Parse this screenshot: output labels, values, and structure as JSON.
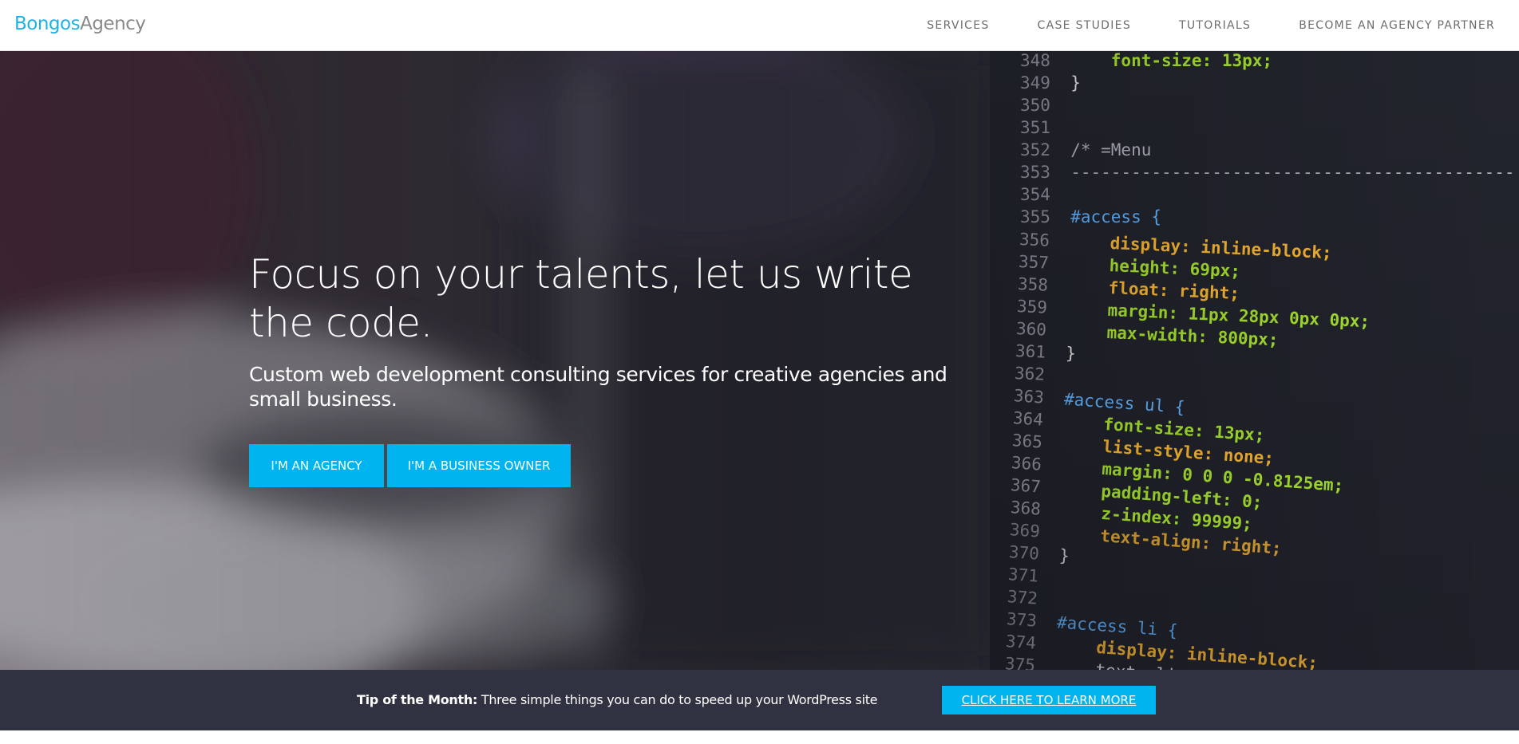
{
  "brand": {
    "part1": "Bongos",
    "part2": "Agency"
  },
  "nav": {
    "items": [
      {
        "label": "SERVICES"
      },
      {
        "label": "CASE STUDIES"
      },
      {
        "label": "TUTORIALS"
      },
      {
        "label": "BECOME AN AGENCY PARTNER"
      }
    ]
  },
  "hero": {
    "title": "Focus on your talents, let us write the code.",
    "subtitle": "Custom web development consulting services for creative agencies and small business.",
    "buttons": {
      "agency": "I'M AN AGENCY",
      "owner": "I'M A BUSINESS OWNER"
    }
  },
  "code": {
    "lines": [
      {
        "n": "348",
        "text": "    font-size: 13px;"
      },
      {
        "n": "349",
        "text": "}"
      },
      {
        "n": "350",
        "text": ""
      },
      {
        "n": "351",
        "text": ""
      },
      {
        "n": "352",
        "text": "/* =Menu"
      },
      {
        "n": "353",
        "text": "--------------------------------------------"
      },
      {
        "n": "354",
        "text": ""
      },
      {
        "n": "355",
        "text": "#access {"
      },
      {
        "n": "356",
        "text": "    display: inline-block;"
      },
      {
        "n": "357",
        "text": "    height: 69px;"
      },
      {
        "n": "358",
        "text": "    float: right;"
      },
      {
        "n": "359",
        "text": "    margin: 11px 28px 0px 0px;"
      },
      {
        "n": "360",
        "text": "    max-width: 800px;"
      },
      {
        "n": "361",
        "text": "}"
      },
      {
        "n": "362",
        "text": ""
      },
      {
        "n": "363",
        "text": "#access ul {"
      },
      {
        "n": "364",
        "text": "    font-size: 13px;"
      },
      {
        "n": "365",
        "text": "    list-style: none;"
      },
      {
        "n": "366",
        "text": "    margin: 0 0 0 -0.8125em;"
      },
      {
        "n": "367",
        "text": "    padding-left: 0;"
      },
      {
        "n": "368",
        "text": "    z-index: 99999;"
      },
      {
        "n": "369",
        "text": "    text-align: right;"
      },
      {
        "n": "370",
        "text": "}"
      },
      {
        "n": "371",
        "text": ""
      },
      {
        "n": "372",
        "text": ""
      },
      {
        "n": "373",
        "text": "#access li {"
      },
      {
        "n": "374",
        "text": "    display: inline-block;"
      },
      {
        "n": "375",
        "text": "    text-align:"
      }
    ]
  },
  "tip": {
    "label": "Tip of the Month:",
    "text": "Three simple things you can do to speed up your WordPress site",
    "button": "CLICK HERE TO LEARN MORE"
  },
  "colors": {
    "accent": "#00b5ef",
    "tipbar": "#303242",
    "logo_primary": "#1ab3e8"
  }
}
